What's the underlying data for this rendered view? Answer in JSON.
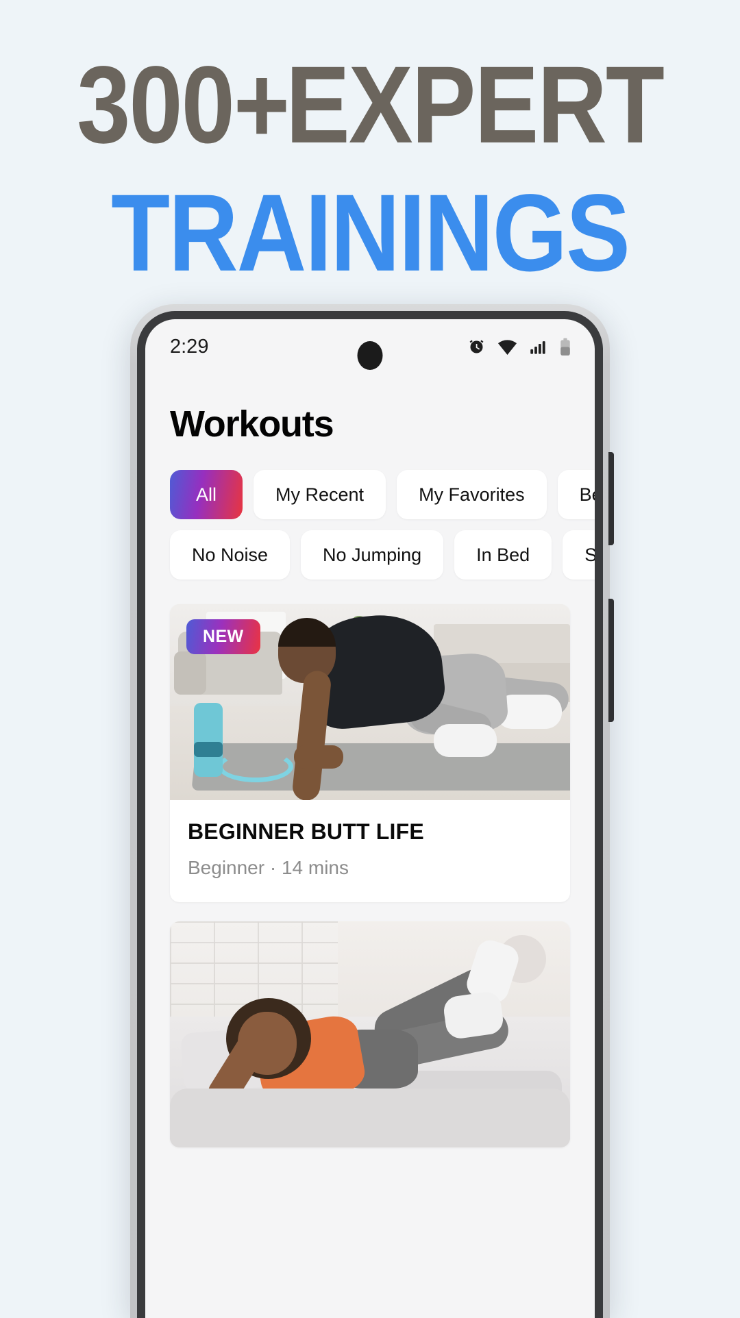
{
  "promo": {
    "line1_number": "300",
    "line1_plus": "+",
    "line1_word": "EXPERT",
    "line2": "TRAININGS",
    "color_line1": "#6b655d",
    "color_line2": "#3b8ded",
    "background": "#eef4f8"
  },
  "statusbar": {
    "time": "2:29",
    "icons": [
      "alarm-icon",
      "wifi-icon",
      "cellular-signal-icon",
      "battery-icon"
    ]
  },
  "header": {
    "title": "Workouts"
  },
  "filters": {
    "active": "All",
    "accent_gradient_start": "#4f5bd5",
    "accent_gradient_mid": "#962fbf",
    "accent_gradient_end": "#e8353f",
    "row1": [
      "All",
      "My Recent",
      "My Favorites",
      "Beginner"
    ],
    "row2": [
      "No Noise",
      "No Jumping",
      "In Bed",
      "Stretch"
    ]
  },
  "workouts": [
    {
      "badge": "NEW",
      "title": "BEGINNER BUTT LIFE",
      "meta": "Beginner · 14 mins",
      "photo": "man-doing-mountain-climbers-photo"
    },
    {
      "badge": "",
      "title": "",
      "meta": "",
      "photo": "woman-doing-leg-raises-in-bed-photo"
    }
  ]
}
